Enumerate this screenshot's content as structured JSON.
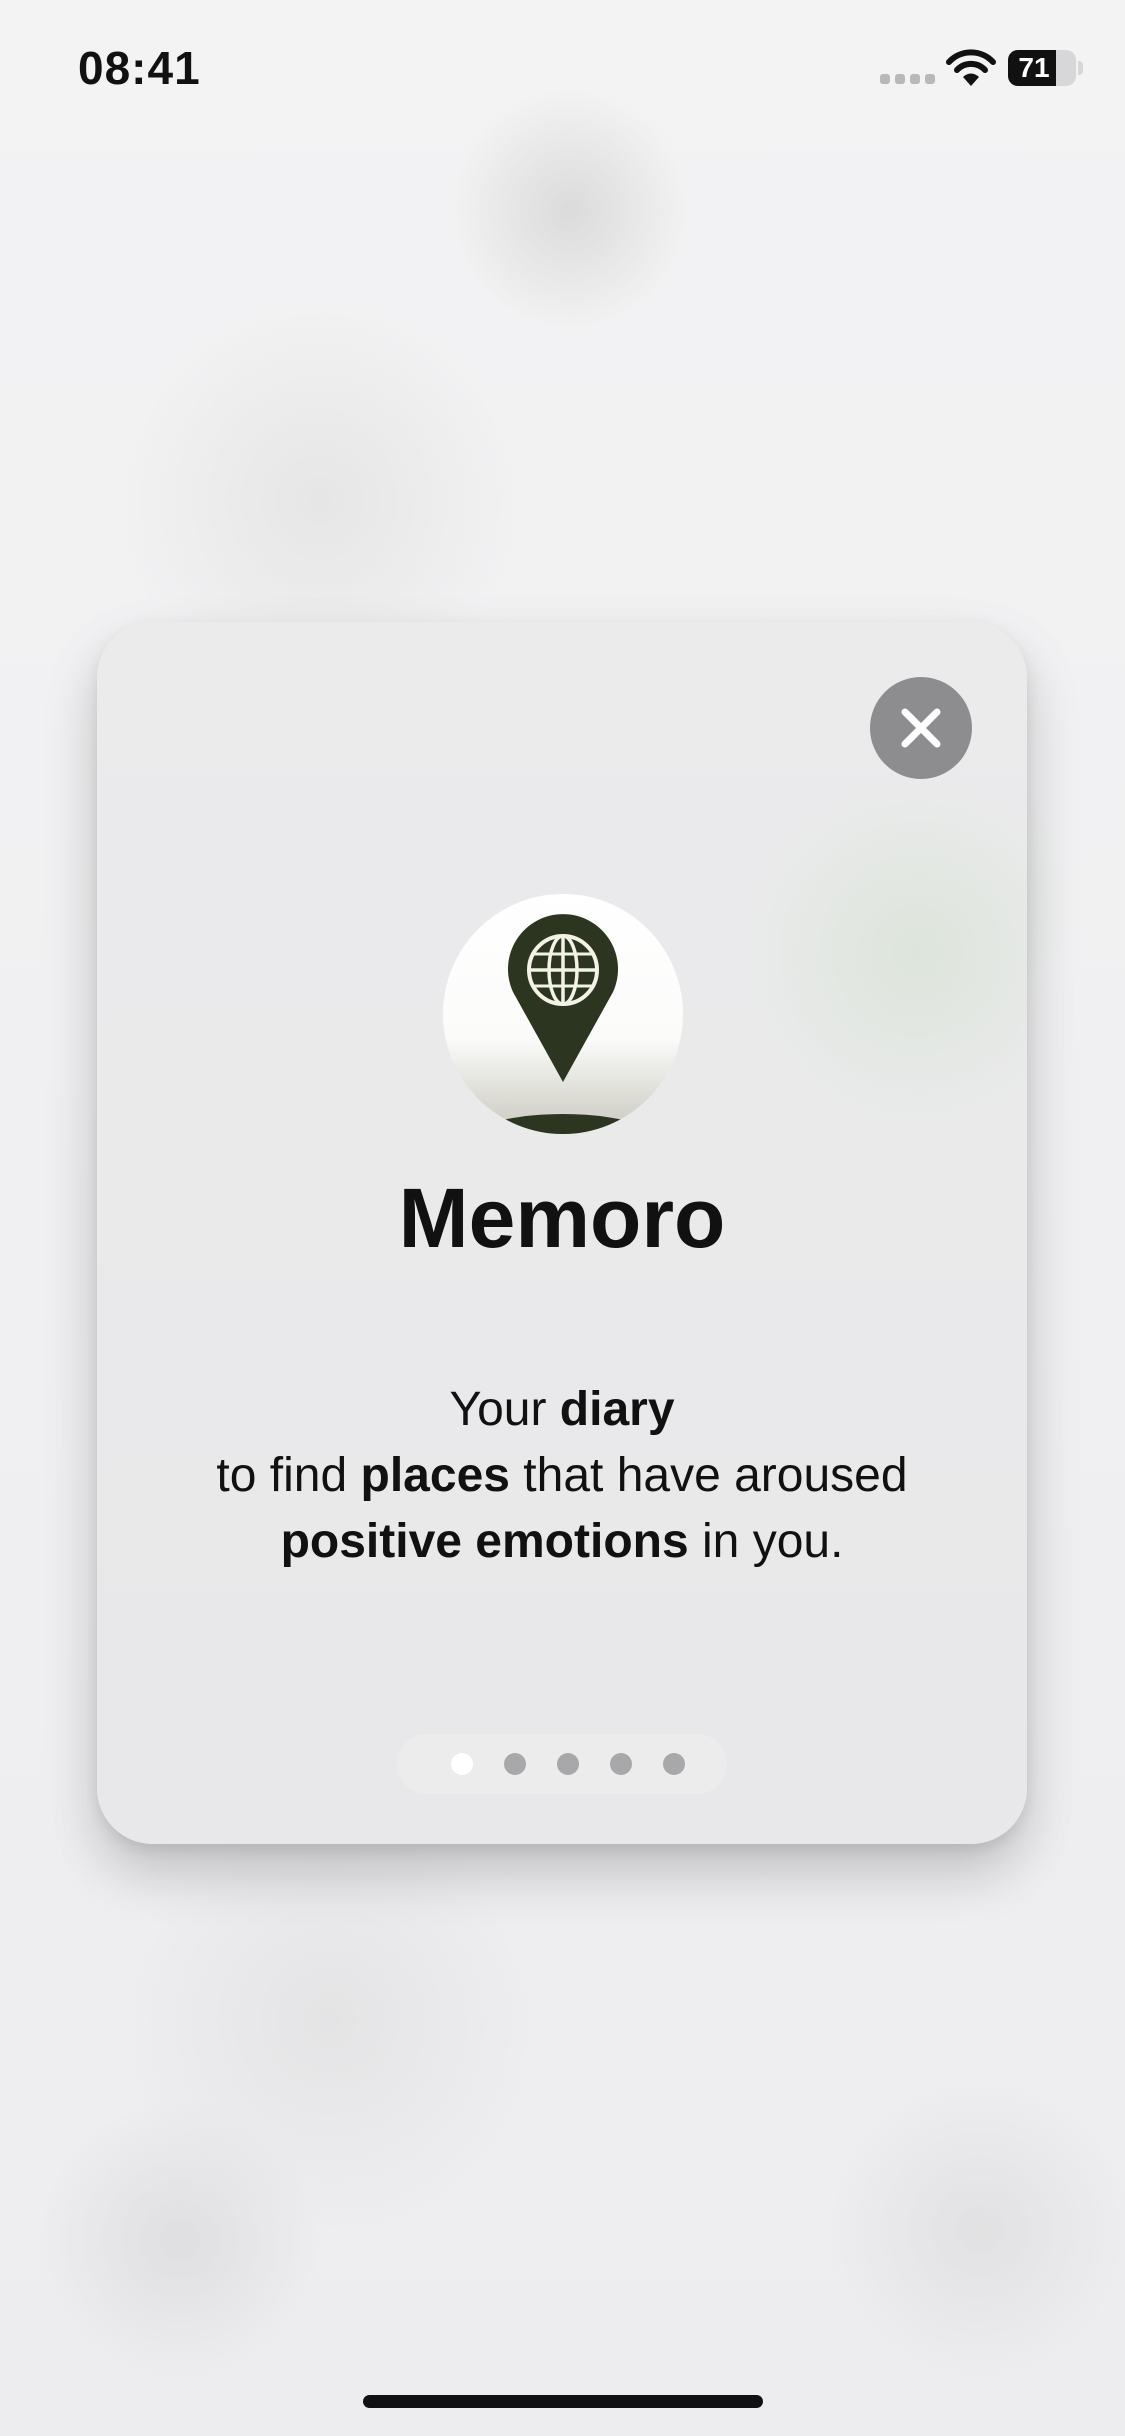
{
  "status_bar": {
    "time": "08:41",
    "battery_level": "71",
    "battery_fraction": 0.71,
    "signal_icon": "cellular-signal-icon",
    "wifi_icon": "wifi-icon",
    "battery_icon": "battery-icon"
  },
  "onboarding": {
    "close_icon": "close-icon",
    "app_icon": "map-pin-globe-icon",
    "app_name": "Memoro",
    "tagline": {
      "line1_pre": "Your ",
      "line1_bold": "diary",
      "line2_pre": "to find ",
      "line2_bold": "places",
      "line2_post": " that have aroused",
      "line3_bold": "positive emotions",
      "line3_post": " in you."
    },
    "pagination": {
      "total": 5,
      "current": 1
    }
  },
  "colors": {
    "accent": "#2c3520",
    "close_button": "#8d8d8f",
    "active_dot": "#ffffff",
    "inactive_dot": "#a8a8aa"
  }
}
